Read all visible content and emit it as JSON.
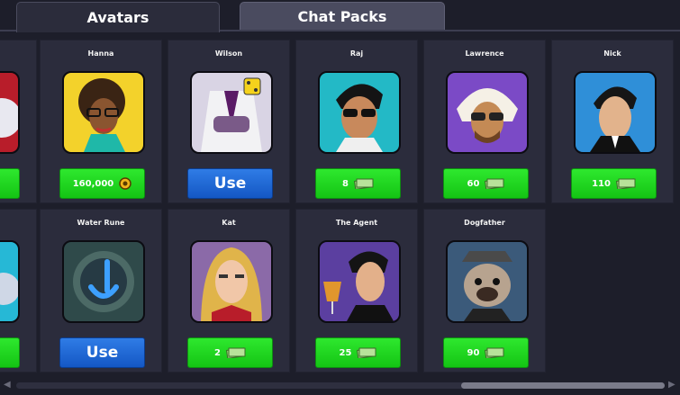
{
  "tabs": [
    {
      "label": "Avatars",
      "active": true
    },
    {
      "label": "Chat Packs",
      "active": false
    }
  ],
  "avatars": [
    {
      "name": "",
      "price": "",
      "currency": "cash",
      "button_color": "#1fd41f",
      "partial": true
    },
    {
      "name": "Hanna",
      "price": "160,000",
      "currency": "coins",
      "button_color": "#1fd41f"
    },
    {
      "name": "Wilson",
      "price": "Use",
      "currency": "none",
      "button_color": "#1f6fdc"
    },
    {
      "name": "Raj",
      "price": "8",
      "currency": "cash",
      "button_color": "#1fd41f"
    },
    {
      "name": "Lawrence",
      "price": "60",
      "currency": "cash",
      "button_color": "#1fd41f"
    },
    {
      "name": "Nick",
      "price": "110",
      "currency": "cash",
      "button_color": "#1fd41f"
    },
    {
      "name": "",
      "price": "",
      "currency": "cash",
      "button_color": "#1fd41f",
      "partial": true
    },
    {
      "name": "Water Rune",
      "price": "Use",
      "currency": "none",
      "button_color": "#1f6fdc"
    },
    {
      "name": "Kat",
      "price": "2",
      "currency": "cash",
      "button_color": "#1fd41f"
    },
    {
      "name": "The Agent",
      "price": "25",
      "currency": "cash",
      "button_color": "#1fd41f"
    },
    {
      "name": "Dogfather",
      "price": "90",
      "currency": "cash",
      "button_color": "#1fd41f"
    }
  ],
  "icons": {
    "coin": "coin-icon",
    "cash": "cash-bill-icon"
  }
}
